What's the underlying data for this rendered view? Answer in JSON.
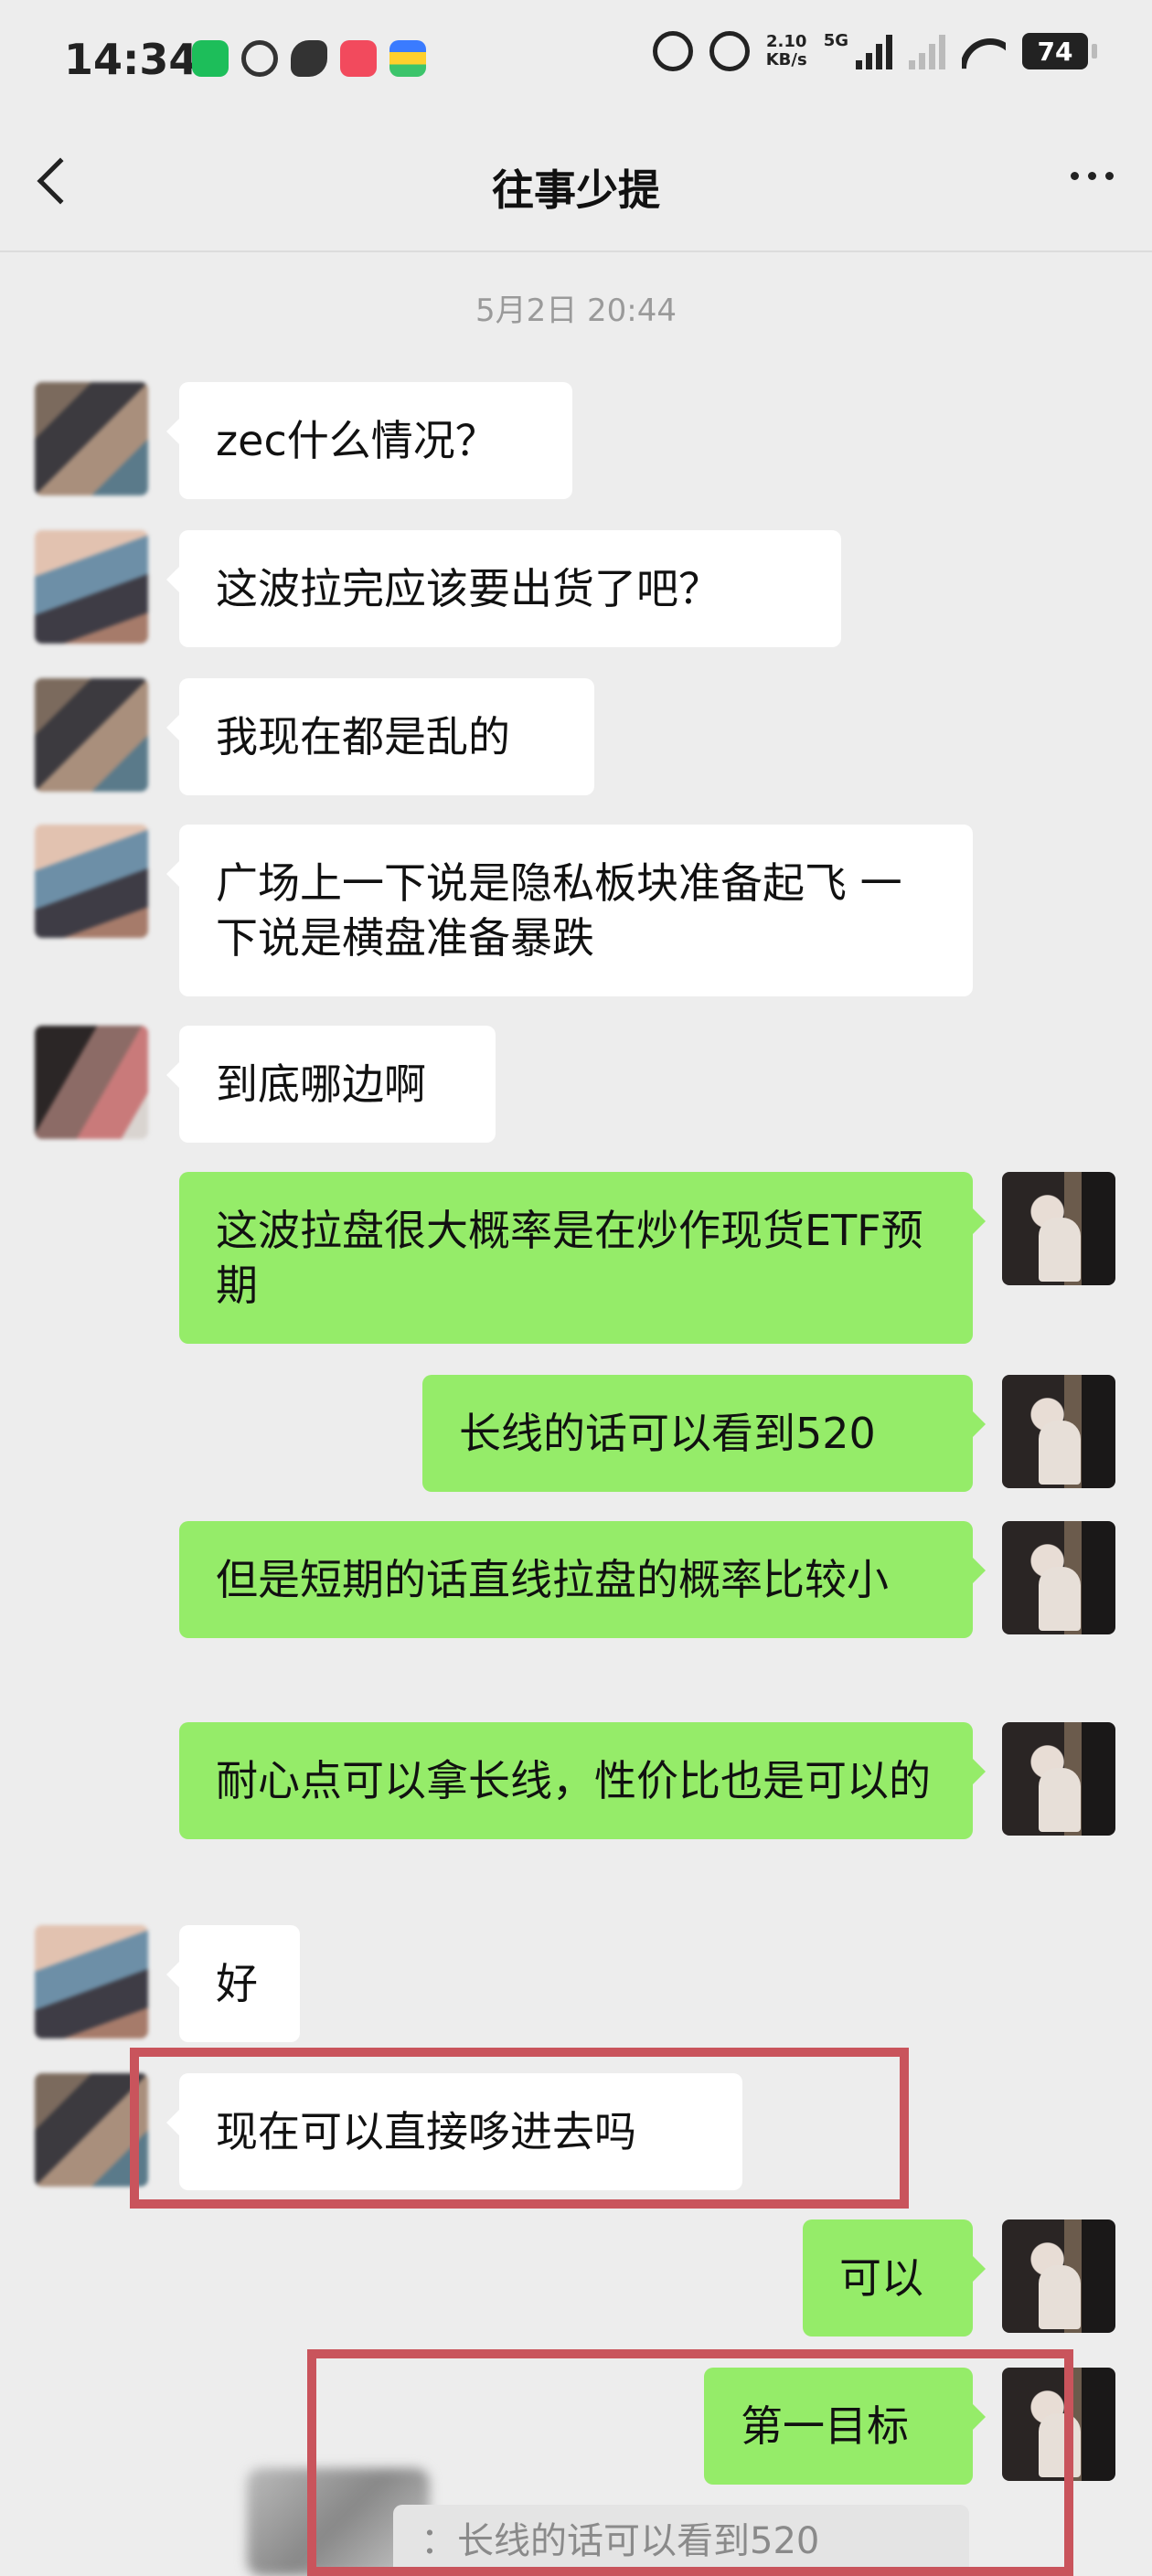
{
  "status_bar": {
    "time": "14:34",
    "net_speed_value": "2.10",
    "net_speed_unit": "KB/s",
    "network_type": "5G",
    "battery": "74"
  },
  "header": {
    "title": "往事少提"
  },
  "conversation": {
    "timestamp": "5月2日 20:44",
    "messages": [
      {
        "side": "in",
        "text": "zec什么情况？"
      },
      {
        "side": "in",
        "text": "这波拉完应该要出货了吧？"
      },
      {
        "side": "in",
        "text": "我现在都是乱的"
      },
      {
        "side": "in",
        "text": "广场上一下说是隐私板块准备起飞 一下说是横盘准备暴跌"
      },
      {
        "side": "in",
        "text": "到底哪边啊"
      },
      {
        "side": "out",
        "text": "这波拉盘很大概率是在炒作现货ETF预期"
      },
      {
        "side": "out",
        "text": "长线的话可以看到520"
      },
      {
        "side": "out",
        "text": "但是短期的话直线拉盘的概率比较小"
      },
      {
        "side": "out",
        "text": "耐心点可以拿长线，性价比也是可以的"
      },
      {
        "side": "in",
        "text": "好"
      },
      {
        "side": "in",
        "text": "现在可以直接哆进去吗"
      },
      {
        "side": "out",
        "text": "可以"
      },
      {
        "side": "out",
        "text": "第一目标"
      }
    ],
    "quote_text": "：长线的话可以看到520"
  },
  "colors": {
    "incoming_bubble": "#ffffff",
    "outgoing_bubble": "#95ec69",
    "highlight_box": "#c9545c",
    "background": "#ededed"
  }
}
